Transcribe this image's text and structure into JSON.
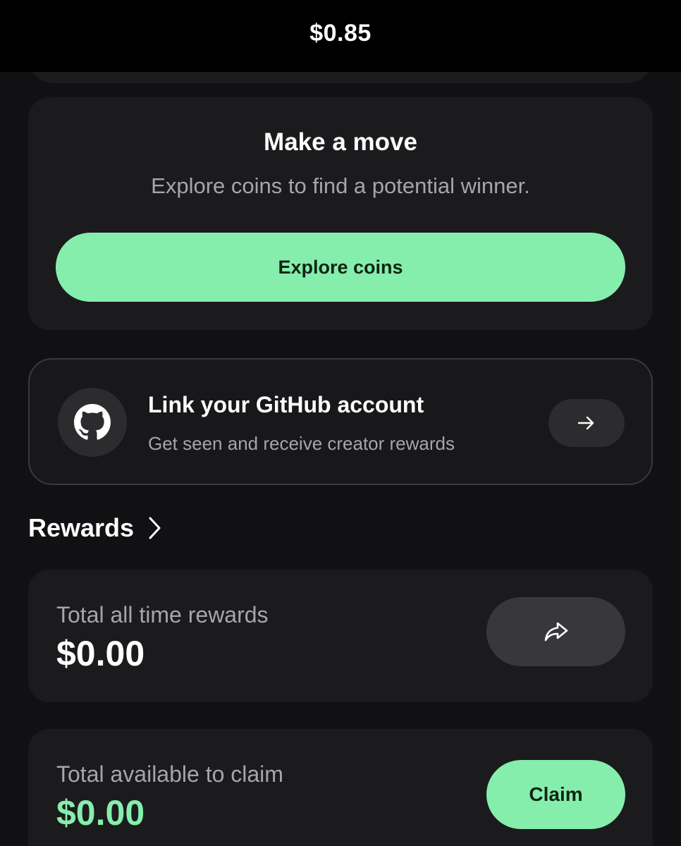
{
  "header": {
    "balance": "$0.85"
  },
  "move_card": {
    "title": "Make a move",
    "subtitle": "Explore coins to find a potential winner.",
    "button_label": "Explore coins"
  },
  "github_card": {
    "icon": "github-icon",
    "title": "Link your GitHub account",
    "subtitle": "Get seen and receive creator rewards",
    "action_icon": "arrow-right-icon"
  },
  "rewards": {
    "title": "Rewards",
    "title_icon": "chevron-right-icon",
    "total": {
      "label": "Total all time rewards",
      "value": "$0.00",
      "action_icon": "share-icon"
    },
    "claimable": {
      "label": "Total available to claim",
      "value": "$0.00",
      "button_label": "Claim"
    }
  },
  "colors": {
    "background": "#111113",
    "card": "#1b1b1d",
    "accent_green": "#86eeac",
    "muted_text": "#a5a5ab"
  }
}
